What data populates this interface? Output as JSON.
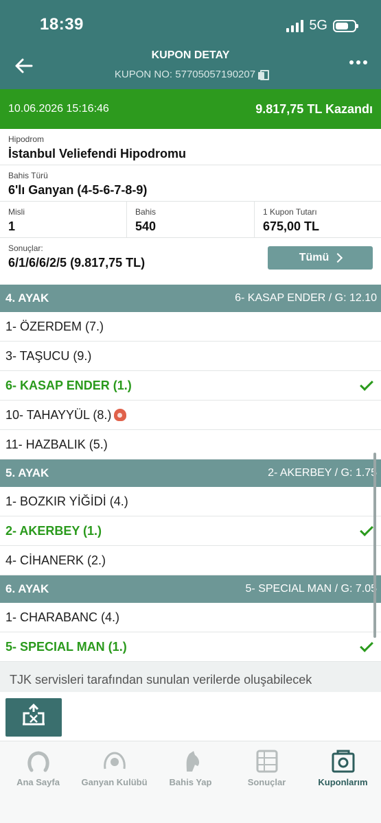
{
  "status": {
    "time": "18:39",
    "network": "5G"
  },
  "header": {
    "title": "KUPON DETAY",
    "coupon_no": "KUPON NO: 57705057190207"
  },
  "banner": {
    "date": "10.06.2026 15:16:46",
    "win_text": "9.817,75 TL Kazandı"
  },
  "info": {
    "hippodrome_label": "Hipodrom",
    "hippodrome_value": "İstanbul Veliefendi Hipodromu",
    "bet_type_label": "Bahis Türü",
    "bet_type_value": "6'lı Ganyan (4-5-6-7-8-9)",
    "misli_label": "Misli",
    "misli_value": "1",
    "bahis_label": "Bahis",
    "bahis_value": "540",
    "kupon_tutari_label": "1 Kupon Tutarı",
    "kupon_tutari_value": "675,00 TL",
    "results_label": "Sonuçlar:",
    "results_value": "6/1/6/6/2/5 (9.817,75 TL)",
    "all_button": "Tümü"
  },
  "legs": [
    {
      "name": "4. AYAK",
      "result": "6- KASAP ENDER / G: 12.10",
      "horses": [
        {
          "label": "1- ÖZERDEM (7.)",
          "winner": false
        },
        {
          "label": "3- TAŞUCU (9.)",
          "winner": false
        },
        {
          "label": "6- KASAP ENDER (1.)",
          "winner": true
        },
        {
          "label": "10- TAHAYYÜL (8.)",
          "winner": false
        },
        {
          "label": "11- HAZBALIK (5.)",
          "winner": false
        }
      ]
    },
    {
      "name": "5. AYAK",
      "result": "2- AKERBEY / G: 1.75",
      "horses": [
        {
          "label": "1- BOZKIR YİĞİDİ (4.)",
          "winner": false
        },
        {
          "label": "2- AKERBEY (1.)",
          "winner": true
        },
        {
          "label": "4- CİHANERK (2.)",
          "winner": false
        }
      ]
    },
    {
      "name": "6. AYAK",
      "result": "5- SPECIAL MAN / G: 7.05",
      "horses": [
        {
          "label": "1- CHARABANC (4.)",
          "winner": false
        },
        {
          "label": "5- SPECIAL MAN (1.)",
          "winner": true
        }
      ]
    }
  ],
  "disclaimer": "TJK servisleri tarafından sunulan verilerde oluşabilecek",
  "nav": {
    "home": "Ana Sayfa",
    "club": "Ganyan Kulübü",
    "bet": "Bahis Yap",
    "results": "Sonuçlar",
    "coupons": "Kuponlarım"
  },
  "colors": {
    "header": "#3b7a78",
    "win_green": "#2d9a1e",
    "leg_header": "#6d9796"
  }
}
